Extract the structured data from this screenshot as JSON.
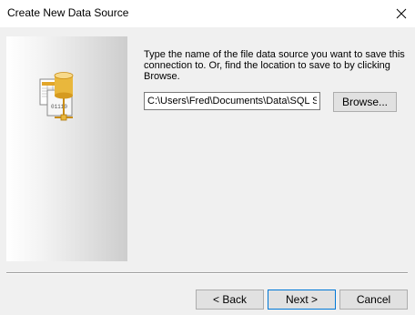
{
  "window": {
    "title": "Create New Data Source",
    "close_icon": "close-icon"
  },
  "side_panel": {
    "icon": "data-source-file-icon",
    "icon_text": "01110"
  },
  "main": {
    "prompt": "Type the name of the file data source you want to save this connection to.  Or, find the location to save to by clicking Browse.",
    "path_value": "C:\\Users\\Fred\\Documents\\Data\\SQL S",
    "browse_label": "Browse..."
  },
  "footer": {
    "back_label": "< Back",
    "next_label": "Next >",
    "cancel_label": "Cancel"
  },
  "colors": {
    "background": "#f0f0f0",
    "titlebar": "#ffffff",
    "button_face": "#e1e1e1",
    "default_button_border": "#0078d7"
  }
}
